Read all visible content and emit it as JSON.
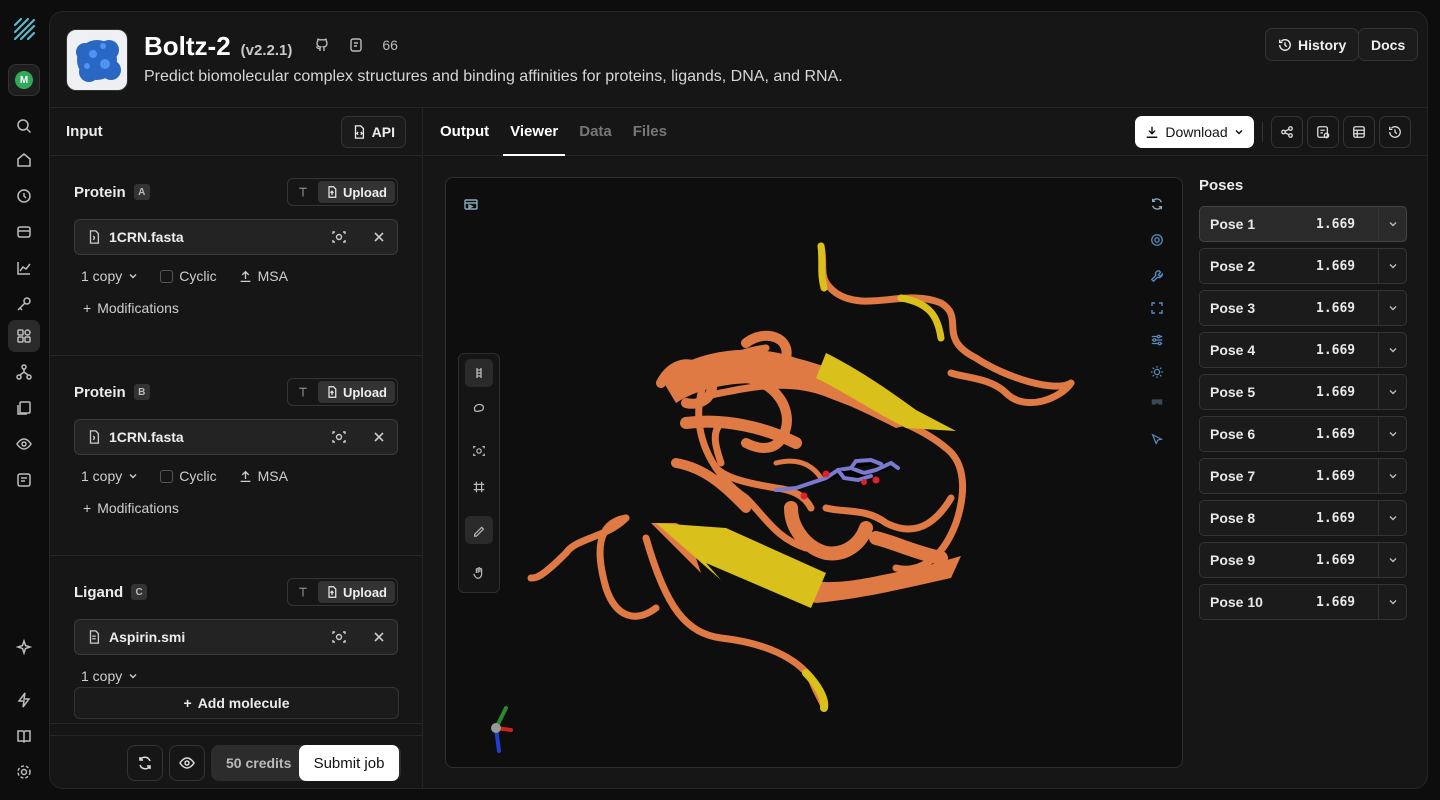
{
  "app": {
    "logo": "logo-icon",
    "avatar_letter": "M"
  },
  "rail": [
    "search-icon",
    "home-icon",
    "history-icon",
    "billing-icon",
    "chart-icon",
    "key-icon",
    "apps-icon",
    "network-icon",
    "docs-icon",
    "eye-icon",
    "list-icon",
    "sparkle-icon",
    "bolt-icon",
    "book-icon",
    "settings-icon"
  ],
  "header": {
    "title": "Boltz-2",
    "version": "(v2.2.1)",
    "stat": "66",
    "description": "Predict biomolecular complex structures and binding affinities for proteins, ligands, DNA, and RNA.",
    "history_label": "History",
    "docs_label": "Docs"
  },
  "input": {
    "title": "Input",
    "api_label": "API",
    "upload_label": "Upload",
    "molecules": [
      {
        "type": "Protein",
        "chain": "A",
        "file": "1CRN.fasta",
        "copies": "1 copy",
        "cyclic": "Cyclic",
        "msa": "MSA",
        "mods": "Modifications"
      },
      {
        "type": "Protein",
        "chain": "B",
        "file": "1CRN.fasta",
        "copies": "1 copy",
        "cyclic": "Cyclic",
        "msa": "MSA",
        "mods": "Modifications"
      },
      {
        "type": "Ligand",
        "chain": "C",
        "file": "Aspirin.smi",
        "copies": "1 copy"
      }
    ],
    "add_molecule": "Add molecule",
    "credits": "50 credits",
    "submit": "Submit job"
  },
  "output": {
    "tabs": [
      "Output",
      "Viewer",
      "Data",
      "Files"
    ],
    "active_tab": "Viewer",
    "download": "Download",
    "poses_title": "Poses",
    "poses": [
      {
        "name": "Pose 1",
        "score": "1.669"
      },
      {
        "name": "Pose 2",
        "score": "1.669"
      },
      {
        "name": "Pose 3",
        "score": "1.669"
      },
      {
        "name": "Pose 4",
        "score": "1.669"
      },
      {
        "name": "Pose 5",
        "score": "1.669"
      },
      {
        "name": "Pose 6",
        "score": "1.669"
      },
      {
        "name": "Pose 7",
        "score": "1.669"
      },
      {
        "name": "Pose 8",
        "score": "1.669"
      },
      {
        "name": "Pose 9",
        "score": "1.669"
      },
      {
        "name": "Pose 10",
        "score": "1.669"
      }
    ],
    "selected_pose": "Pose 1"
  },
  "colors": {
    "protein": "#e07a45",
    "sheet": "#d9c01a",
    "ligand": "#7a7ad0",
    "oxygen": "#e0202a",
    "accent": "#ffffff"
  }
}
